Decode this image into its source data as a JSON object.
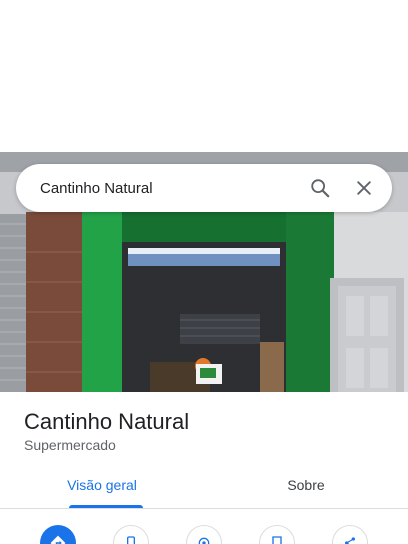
{
  "search": {
    "query": "Cantinho Natural",
    "search_icon": "search-icon",
    "close_icon": "close-icon"
  },
  "place": {
    "name": "Cantinho Natural",
    "category": "Supermercado"
  },
  "tabs": [
    {
      "label": "Visão geral",
      "active": true
    },
    {
      "label": "Sobre",
      "active": false
    }
  ],
  "actions": [
    {
      "icon": "directions-icon",
      "style": "primary"
    },
    {
      "icon": "phone-icon",
      "style": "outline"
    },
    {
      "icon": "location-icon",
      "style": "outline"
    },
    {
      "icon": "save-icon",
      "style": "outline"
    },
    {
      "icon": "share-icon",
      "style": "outline"
    }
  ],
  "colors": {
    "accent": "#1a73e8",
    "storefront_green": "#1e8a3c"
  }
}
